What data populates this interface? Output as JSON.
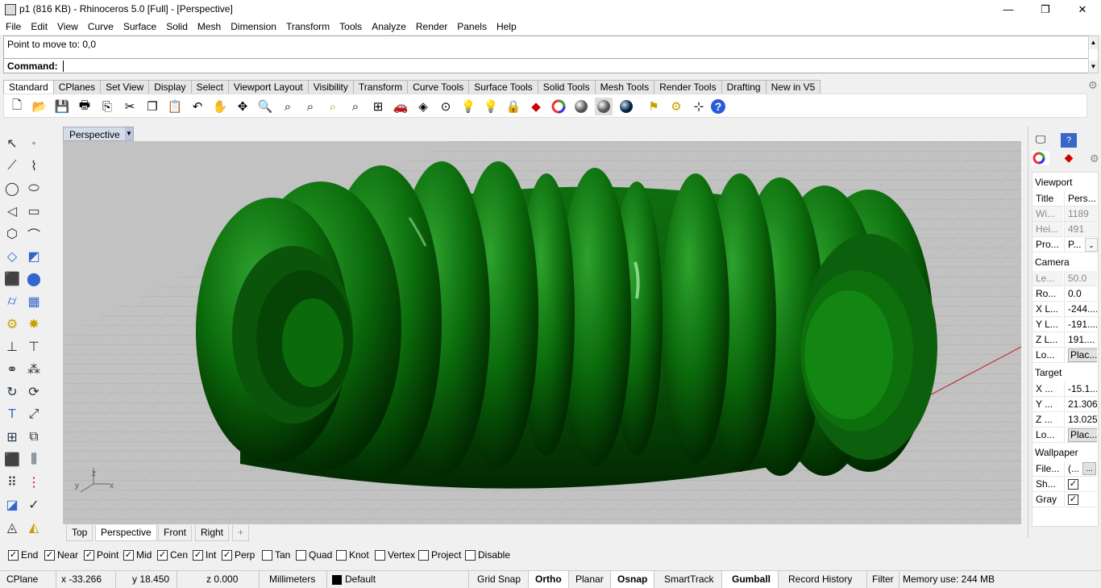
{
  "window": {
    "title": "p1 (816 KB) - Rhinoceros 5.0 [Full] - [Perspective]",
    "minimize": "—",
    "restore": "❐",
    "close": "✕"
  },
  "menu": [
    "File",
    "Edit",
    "View",
    "Curve",
    "Surface",
    "Solid",
    "Mesh",
    "Dimension",
    "Transform",
    "Tools",
    "Analyze",
    "Render",
    "Panels",
    "Help"
  ],
  "command": {
    "history": "Point to move to: 0,0",
    "prompt": "Command:",
    "value": ""
  },
  "toolbar_tabs": [
    "Standard",
    "CPlanes",
    "Set View",
    "Display",
    "Select",
    "Viewport Layout",
    "Visibility",
    "Transform",
    "Curve Tools",
    "Surface Tools",
    "Solid Tools",
    "Mesh Tools",
    "Render Tools",
    "Drafting",
    "New in V5"
  ],
  "toolbar_icons": [
    "new-icon",
    "open-icon",
    "save-icon",
    "print-icon",
    "import-icon",
    "cut-icon",
    "copy-icon",
    "paste-icon",
    "undo-icon",
    "pan-icon",
    "rotate-view-icon",
    "zoom-icon",
    "zoom-window-icon",
    "zoom-extents-icon",
    "zoom-selected-icon",
    "zoom-all-icon",
    "four-viewports-icon",
    "car-icon",
    "named-view-icon",
    "cplane-icon",
    "light-icon",
    "bulb-icon",
    "lock-icon",
    "layer-icon",
    "color-wheel-icon",
    "shaded-sphere-icon",
    "rendered-sphere-icon",
    "blue-sphere-icon",
    "flag-icon",
    "gear-icon",
    "snap-icon",
    "help-icon"
  ],
  "viewport": {
    "name": "Perspective",
    "axis_x": "x",
    "axis_y": "y",
    "axis_z": "z",
    "object_color": "#0b6b0b",
    "tabs": [
      "Top",
      "Perspective",
      "Front",
      "Right"
    ],
    "add_tab": "+"
  },
  "properties": {
    "viewport_header": "Viewport",
    "viewport_rows": [
      {
        "label": "Title",
        "value": "Pers...",
        "dim": false
      },
      {
        "label": "Wi...",
        "value": "1189",
        "dim": true
      },
      {
        "label": "Hei...",
        "value": "491",
        "dim": true
      },
      {
        "label": "Pro...",
        "value": "P...",
        "dim": false
      }
    ],
    "camera_header": "Camera",
    "camera_rows": [
      {
        "label": "Le...",
        "value": "50.0",
        "dim": true
      },
      {
        "label": "Ro...",
        "value": "0.0",
        "dim": false
      },
      {
        "label": "X L...",
        "value": "-244....",
        "dim": false
      },
      {
        "label": "Y L...",
        "value": "-191....",
        "dim": false
      },
      {
        "label": "Z L...",
        "value": "191....",
        "dim": false
      },
      {
        "label": "Lo...",
        "value": "Plac...",
        "dim": false
      }
    ],
    "target_header": "Target",
    "target_rows": [
      {
        "label": "X ...",
        "value": "-15.1...",
        "dim": false
      },
      {
        "label": "Y ...",
        "value": "21.306",
        "dim": false
      },
      {
        "label": "Z ...",
        "value": "13.025",
        "dim": false
      },
      {
        "label": "Lo...",
        "value": "Plac...",
        "dim": false
      }
    ],
    "wallpaper_header": "Wallpaper",
    "wallpaper_rows": [
      {
        "label": "File...",
        "value": "(...",
        "dim": false
      },
      {
        "label": "Sh...",
        "value": "✓",
        "dim": false
      },
      {
        "label": "Gray",
        "value": "✓",
        "dim": false
      }
    ]
  },
  "osnaps": [
    {
      "label": "End",
      "checked": true
    },
    {
      "label": "Near",
      "checked": true
    },
    {
      "label": "Point",
      "checked": true
    },
    {
      "label": "Mid",
      "checked": true
    },
    {
      "label": "Cen",
      "checked": true
    },
    {
      "label": "Int",
      "checked": true
    },
    {
      "label": "Perp",
      "checked": true
    },
    {
      "label": "Tan",
      "checked": false
    },
    {
      "label": "Quad",
      "checked": false
    },
    {
      "label": "Knot",
      "checked": false
    },
    {
      "label": "Vertex",
      "checked": false
    },
    {
      "label": "Project",
      "checked": false
    },
    {
      "label": "Disable",
      "checked": false
    }
  ],
  "status": {
    "cplane": "CPlane",
    "x": "x -33.266",
    "y": "y 18.450",
    "z": "z 0.000",
    "units": "Millimeters",
    "layer": "Default",
    "grid_snap": "Grid Snap",
    "ortho": "Ortho",
    "planar": "Planar",
    "osnap": "Osnap",
    "smarttrack": "SmartTrack",
    "gumball": "Gumball",
    "record_history": "Record History",
    "filter": "Filter",
    "memory": "Memory use: 244 MB"
  }
}
